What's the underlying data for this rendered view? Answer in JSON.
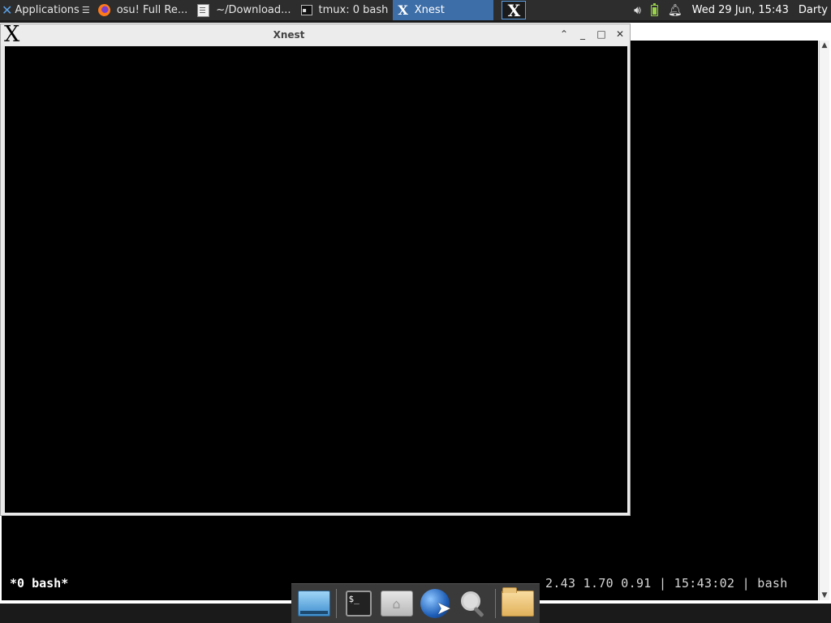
{
  "top_panel": {
    "applications_label": "Applications",
    "tasks": [
      {
        "label": "osu! Full Re...",
        "icon": "firefox-icon"
      },
      {
        "label": "~/Download...",
        "icon": "text-editor-icon"
      },
      {
        "label": "tmux: 0 bash",
        "icon": "terminal-icon"
      },
      {
        "label": "Xnest",
        "icon": "x-icon",
        "active": true
      }
    ],
    "clock": "Wed 29 Jun, 15:43",
    "user": "Darty"
  },
  "xnest_window": {
    "title": "Xnest"
  },
  "tmux": {
    "status_left": "*0 bash*",
    "status_right": "2.43 1.70 0.91 | 15:43:02 | bash"
  },
  "dock": {
    "items": [
      "desktop-icon",
      "terminal-icon",
      "home-folder-icon",
      "web-browser-icon",
      "search-icon",
      "folder-icon"
    ]
  },
  "colors": {
    "panel_bg": "#2d2d2d",
    "active_task": "#3d6ea8",
    "terminal_bg": "#000000"
  }
}
